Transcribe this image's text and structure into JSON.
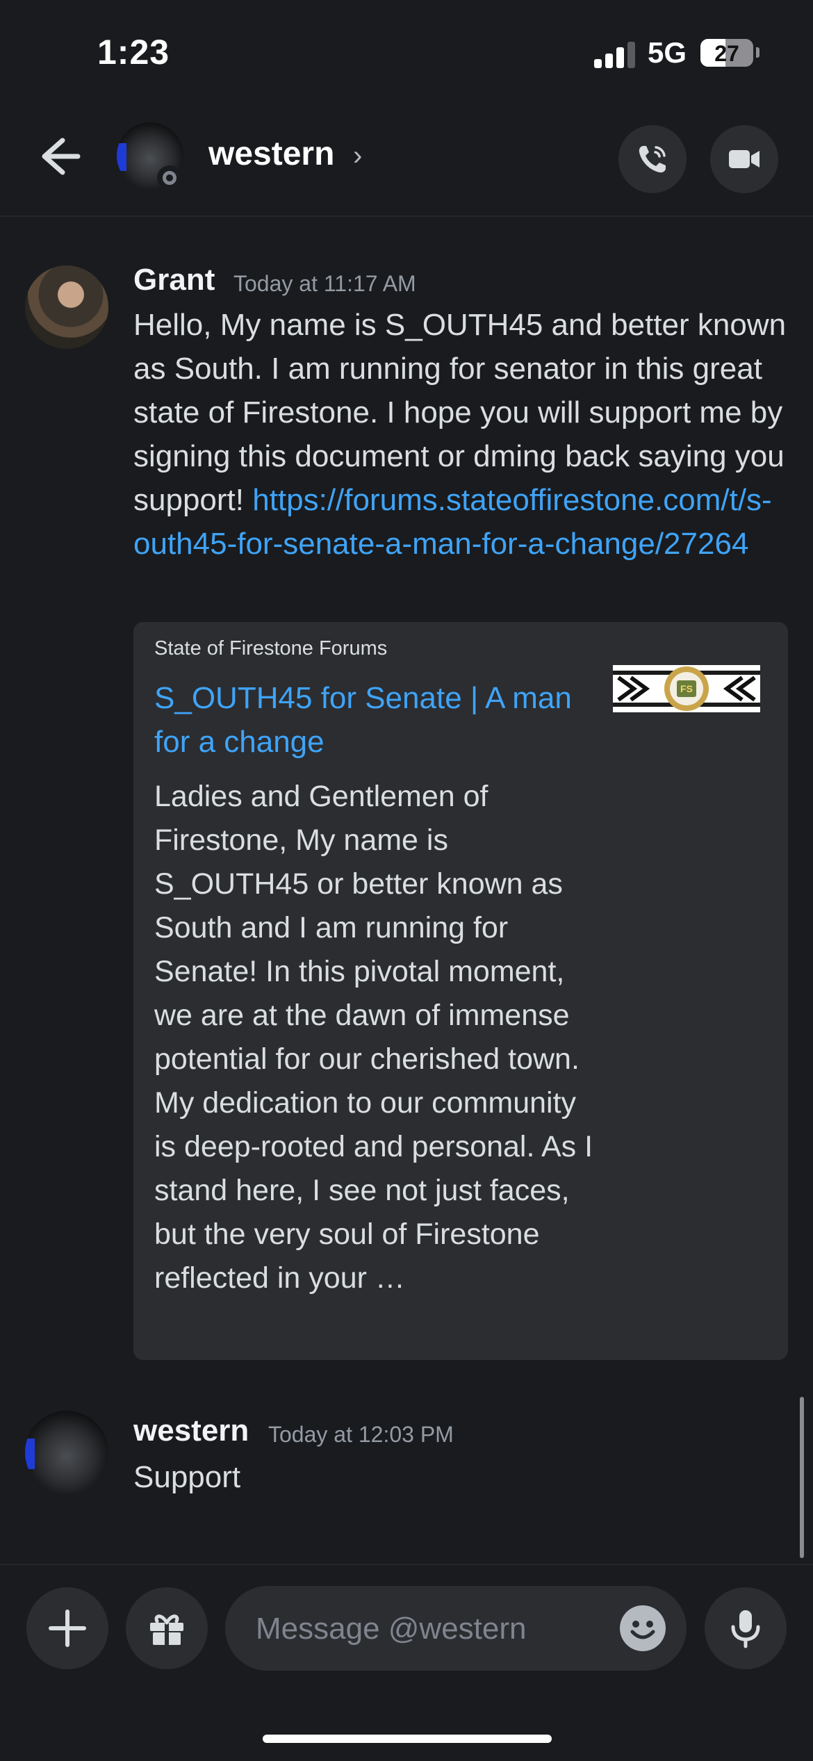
{
  "status_bar": {
    "time": "1:23",
    "network": "5G",
    "battery": "27"
  },
  "header": {
    "name": "western",
    "chevron": "›",
    "icons": [
      "back-arrow-icon",
      "phone-icon",
      "video-camera-icon"
    ]
  },
  "messages": [
    {
      "author": "Grant",
      "timestamp": "Today at 11:17 AM",
      "text": "Hello, My name is S_OUTH45 and better known as South. I am running for senator in this great state of Firestone. I hope you will support me by signing this document or dming back saying you support! ",
      "link": "https://forums.stateoffirestone.com/t/s-outh45-for-senate-a-man-for-a-change/27264",
      "embed": {
        "provider": "State of Firestone Forums",
        "title": "S_OUTH45 for Senate | A man for a change",
        "description": "Ladies and Gentlemen of Firestone,  My name is S_OUTH45 or better known as South and I am running for Senate!  In this pivotal moment, we are at the dawn of immense potential for our cherished town. My dedication to our community is deep-rooted and personal. As I stand here, I see not just faces, but the very soul of Firestone reflected in your …",
        "thumbnail_text": "FS"
      }
    },
    {
      "author": "western",
      "timestamp": "Today at 12:03 PM",
      "text": "Support"
    }
  ],
  "composer": {
    "placeholder": "Message @western",
    "icons": [
      "plus-icon",
      "gift-icon",
      "emoji-icon",
      "microphone-icon"
    ]
  },
  "colors": {
    "background": "#1a1b1e",
    "surface": "#2b2d31",
    "link": "#3fa4f7",
    "muted": "#949ba4"
  }
}
